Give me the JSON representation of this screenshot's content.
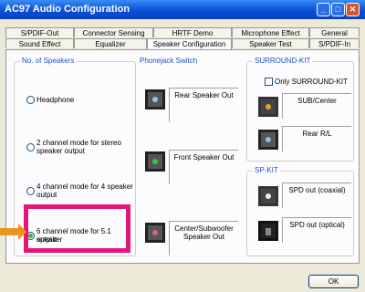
{
  "window": {
    "title": "AC97 Audio Configuration"
  },
  "tabs_row1": [
    "S/PDIF-Out",
    "Connector Sensing",
    "HRTF Demo",
    "Microphone Effect",
    "General"
  ],
  "tabs_row2": [
    "Sound Effect",
    "Equalizer",
    "Speaker Configuration",
    "Speaker Test",
    "S/PDIF-In"
  ],
  "active_tab": "Speaker Configuration",
  "speakers": {
    "title": "No. of Speakers",
    "options": [
      {
        "label": "Headphone",
        "selected": false
      },
      {
        "label": "2 channel mode for stereo speaker output",
        "line1": "2 channel mode for stereo",
        "line2": "speaker output",
        "selected": false
      },
      {
        "label": "4 channel mode for 4 speaker output",
        "line1": "4 channel mode for 4 speaker",
        "line2": "output",
        "selected": false
      },
      {
        "label": "6 channel mode for 5.1 speaker output",
        "line1": "6 channel mode for 5.1 speaker",
        "line2": "output",
        "selected": true
      }
    ]
  },
  "phonejack": {
    "title": "Phonejack Switch",
    "jacks": [
      {
        "label": "Rear Speaker Out",
        "color": "blue"
      },
      {
        "label": "Front Speaker Out",
        "color": "green"
      },
      {
        "label1": "Center/Subwoofer",
        "label2": "Speaker Out",
        "color": "pink"
      }
    ]
  },
  "surround": {
    "title": "SURROUND-KIT",
    "only_label": "Only SURROUND-KIT",
    "only_checked": false,
    "jacks": [
      {
        "label": "SUB/Center",
        "color": "orange"
      },
      {
        "label": "Rear R/L",
        "color": "blue"
      }
    ]
  },
  "spkit": {
    "title": "SP-KIT",
    "jacks": [
      {
        "label": "SPD out (coaxial)",
        "color": "white"
      },
      {
        "label": "SPD out (optical)",
        "color": "optical"
      }
    ]
  },
  "buttons": {
    "ok": "OK"
  },
  "colors": {
    "highlight": "#e5167a",
    "arrow": "#e8961e",
    "group_title": "#2050c0"
  }
}
